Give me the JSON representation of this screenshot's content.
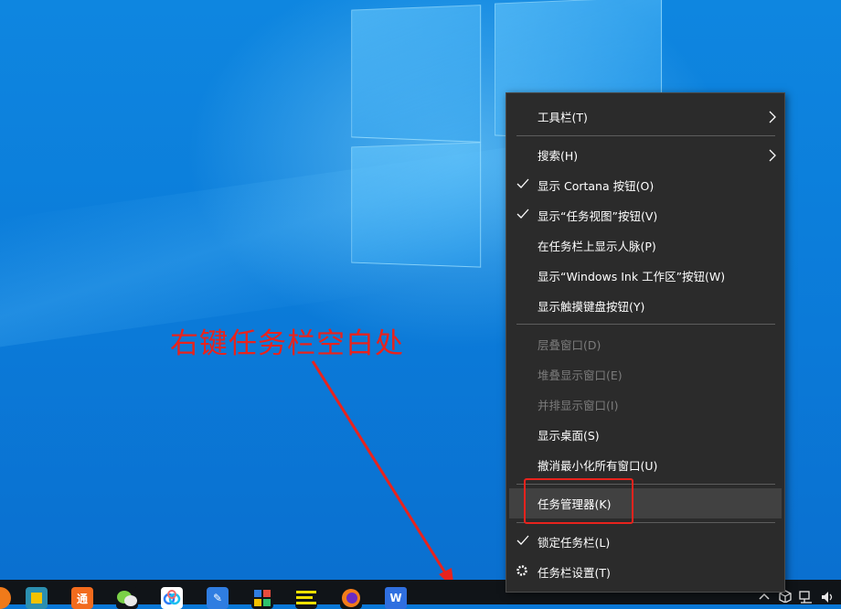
{
  "annotation": {
    "text": "右键任务栏空白处",
    "color": "#e8231d"
  },
  "context_menu": {
    "items": [
      {
        "label": "工具栏(T)",
        "submenu": true
      },
      {
        "label": "搜索(H)",
        "submenu": true
      },
      {
        "label": "显示 Cortana 按钮(O)",
        "checked": true
      },
      {
        "label": "显示“任务视图”按钮(V)",
        "checked": true
      },
      {
        "label": "在任务栏上显示人脉(P)"
      },
      {
        "label": "显示“Windows Ink 工作区”按钮(W)"
      },
      {
        "label": "显示触摸键盘按钮(Y)"
      },
      {
        "label": "层叠窗口(D)",
        "disabled": true
      },
      {
        "label": "堆叠显示窗口(E)",
        "disabled": true
      },
      {
        "label": "并排显示窗口(I)",
        "disabled": true
      },
      {
        "label": "显示桌面(S)"
      },
      {
        "label": "撤消最小化所有窗口(U)"
      },
      {
        "label": "任务管理器(K)",
        "highlighted": true
      },
      {
        "label": "锁定任务栏(L)",
        "checked": true
      },
      {
        "label": "任务栏设置(T)",
        "icon": "gear-icon"
      }
    ]
  },
  "taskbar": {
    "icons": [
      {
        "name": "orange-app-icon",
        "glyph": ""
      },
      {
        "name": "folder-app-icon",
        "glyph": ""
      },
      {
        "name": "tong-app-icon",
        "glyph": "通"
      },
      {
        "name": "wechat-icon",
        "glyph": ""
      },
      {
        "name": "baidu-netdisk-icon",
        "glyph": ""
      },
      {
        "name": "edit-app-icon",
        "glyph": "✎"
      },
      {
        "name": "tiles-app-icon",
        "glyph": ""
      },
      {
        "name": "notes-app-icon",
        "glyph": "≡"
      },
      {
        "name": "firefox-icon",
        "glyph": ""
      },
      {
        "name": "wps-icon",
        "glyph": "W"
      }
    ],
    "tray_icons": [
      "chevron-up-icon",
      "package-icon",
      "network-icon",
      "volume-icon"
    ]
  },
  "colors": {
    "menu_bg": "#2b2b2b",
    "highlight_bg": "#414141",
    "separator": "#5d5d5d",
    "desktop": "#0a78d7"
  }
}
